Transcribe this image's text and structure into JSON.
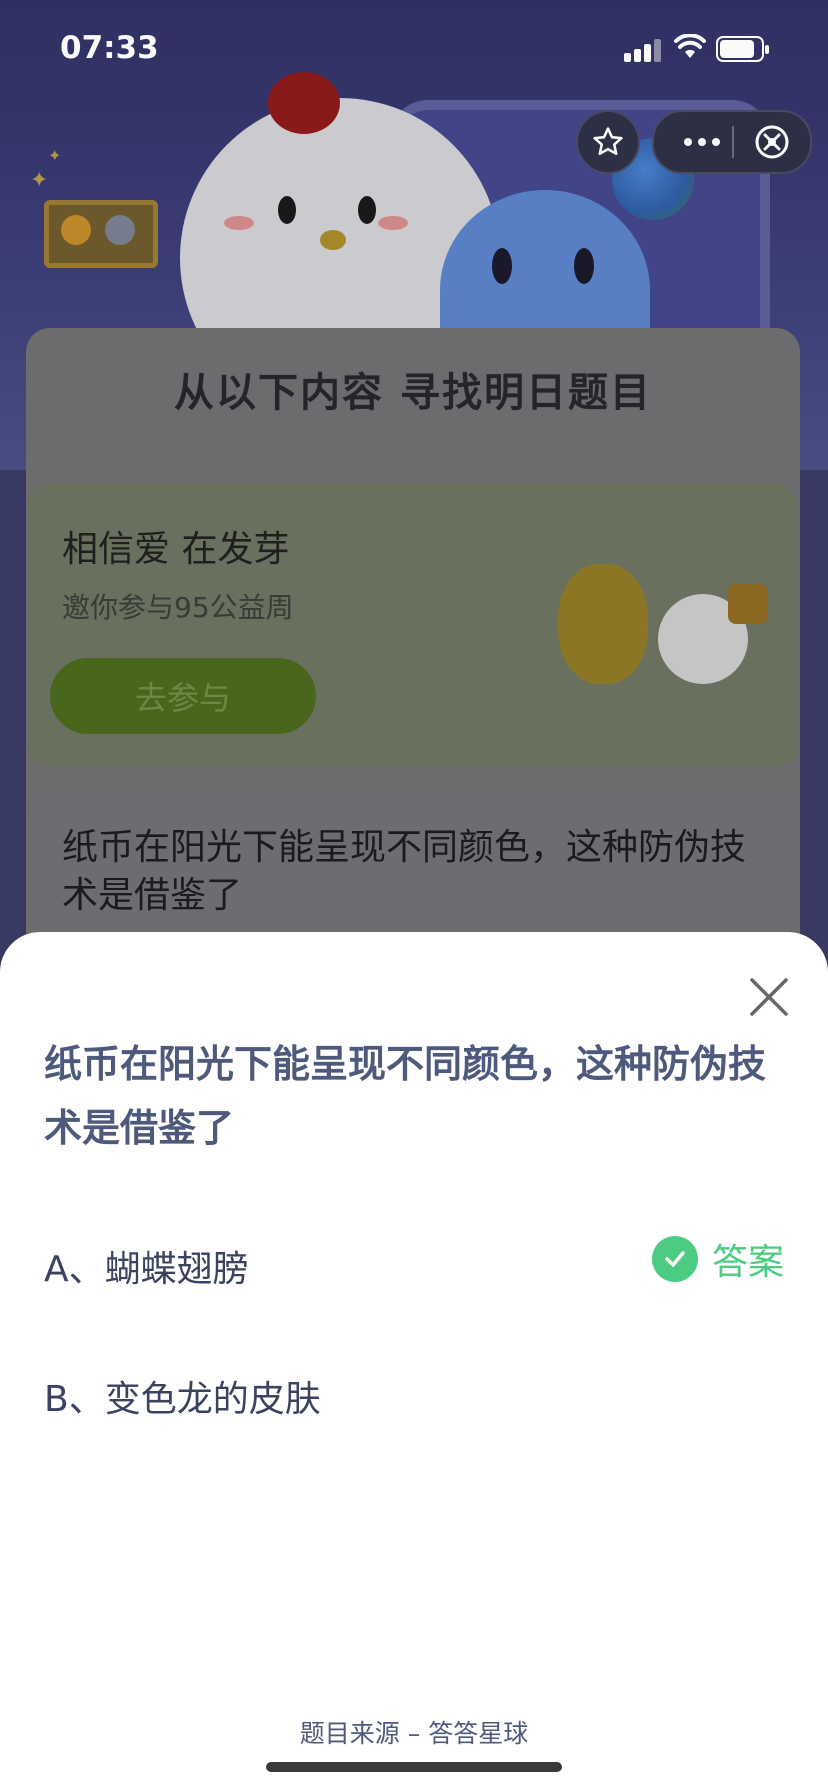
{
  "status_bar": {
    "time": "07:33",
    "battery_level": 0.95,
    "signal_bars": 3
  },
  "capsule": {
    "favorite_icon": "star-icon",
    "more_icon": "more-dots-icon",
    "close_icon": "close-circle-icon"
  },
  "background": {
    "section_title": "从以下内容 寻找明日题目",
    "promo": {
      "title": "相信爱 在发芽",
      "subtitle": "邀你参与95公益周",
      "button_label": "去参与"
    },
    "question_card": {
      "text": "纸币在阳光下能呈现不同颜色，这种防伪技术是借鉴了"
    }
  },
  "sheet": {
    "close_icon": "close-icon",
    "question": "纸币在阳光下能呈现不同颜色，这种防伪技术是借鉴了",
    "options": [
      {
        "label": "A、蝴蝶翅膀",
        "is_answer": true
      },
      {
        "label": "B、变色龙的皮肤",
        "is_answer": false
      }
    ],
    "answer_label": "答案",
    "answer_color": "#4ccb83",
    "source": "题目来源 – 答答星球"
  }
}
